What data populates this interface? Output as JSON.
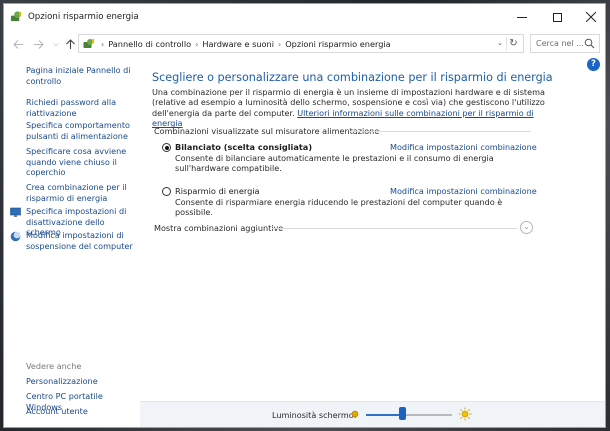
{
  "window": {
    "title": "Opzioni risparmio energia"
  },
  "address": {
    "crumbs": [
      "Pannello di controllo",
      "Hardware e suoni",
      "Opzioni risparmio energia"
    ],
    "search_placeholder": "Cerca nel ..."
  },
  "sidebar": {
    "links": [
      "Pagina iniziale Pannello di controllo",
      "Richiedi password alla riattivazione",
      "Specifica comportamento pulsanti di alimentazione",
      "Specificare cosa avviene quando viene chiuso il coperchio",
      "Crea combinazione per il risparmio di energia",
      "Specifica impostazioni di disattivazione dello schermo",
      "Modifica impostazioni di sospensione del computer"
    ],
    "see_also_label": "Vedere anche",
    "see_also": [
      "Personalizzazione",
      "Centro PC portatile Windows",
      "Account utente"
    ]
  },
  "main": {
    "heading": "Scegliere o personalizzare una combinazione per il risparmio di energia",
    "intro": "Una combinazione per il risparmio di energia è un insieme di impostazioni hardware e di sistema (relative ad esempio a luminosità dello schermo, sospensione e così via) che gestiscono l'utilizzo dell'energia da parte del computer.",
    "intro_link": "Ulteriori informazioni sulle combinazioni per il risparmio di energia",
    "section_label": "Combinazioni visualizzate sul misuratore alimentazione",
    "plans": [
      {
        "name": "Bilanciato (scelta consigliata)",
        "selected": true,
        "link": "Modifica impostazioni combinazione",
        "desc": "Consente di bilanciare automaticamente le prestazioni e il consumo di energia sull'hardware compatibile."
      },
      {
        "name": "Risparmio di energia",
        "selected": false,
        "link": "Modifica impostazioni combinazione",
        "desc": "Consente di risparmiare energia riducendo le prestazioni del computer quando è possibile."
      }
    ],
    "more_label": "Mostra combinazioni aggiuntive"
  },
  "bottom": {
    "brightness_label": "Luminosità schermo:",
    "brightness_level": 0.42
  },
  "colors": {
    "link": "#1a4a8a",
    "heading": "#1d5fa8",
    "accent": "#1d63bd"
  }
}
